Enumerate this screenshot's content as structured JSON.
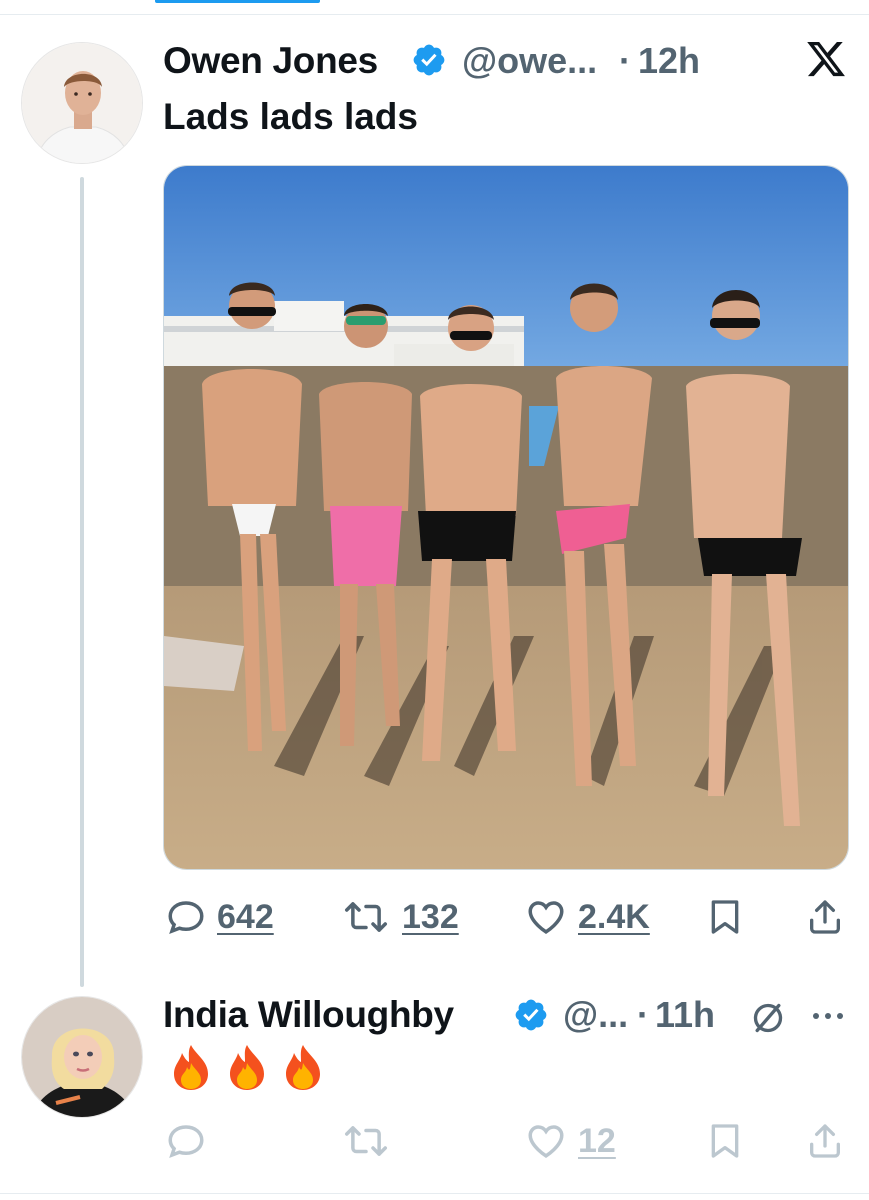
{
  "tweet": {
    "author_name": "Owen Jones",
    "handle": "@owe...",
    "separator": "·",
    "time": "12h",
    "text": "Lads lads lads",
    "stats": {
      "replies": "642",
      "reposts": "132",
      "likes": "2.4K"
    }
  },
  "reply": {
    "author_name": "India Willoughby",
    "handle": "@...",
    "separator": "·",
    "time": "11h",
    "text_emojis": [
      "fire",
      "fire",
      "fire"
    ],
    "stats": {
      "replies": "",
      "reposts": "",
      "likes": "12"
    }
  },
  "colors": {
    "accent": "#1d9bf0",
    "text": "#0f1419",
    "muted": "#536471",
    "divider": "#cfd9de"
  },
  "icons": [
    "x-logo-icon",
    "verified-badge-icon",
    "reply-icon",
    "repost-icon",
    "like-icon",
    "bookmark-icon",
    "share-icon",
    "muted-icon",
    "more-icon",
    "fire-emoji"
  ]
}
